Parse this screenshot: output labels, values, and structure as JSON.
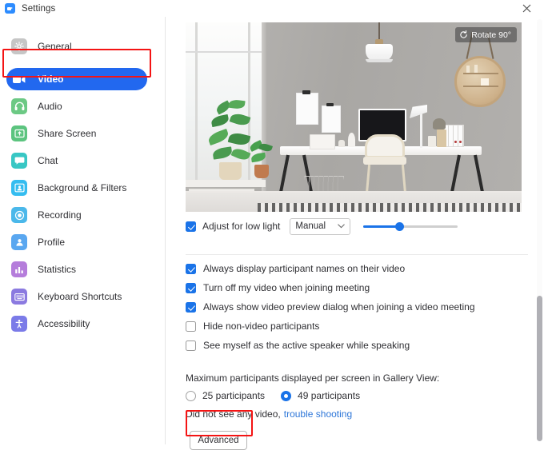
{
  "window": {
    "title": "Settings",
    "logo_icon": "zoom-logo-icon",
    "close_icon": "close-icon"
  },
  "sidebar": {
    "items": [
      {
        "label": "General",
        "icon": "gear-icon",
        "color": "#bdbdbd",
        "active": false
      },
      {
        "label": "Video",
        "icon": "video-camera-icon",
        "color": "#2268ef",
        "active": true
      },
      {
        "label": "Audio",
        "icon": "headphones-icon",
        "color": "#56c271",
        "active": false
      },
      {
        "label": "Share Screen",
        "icon": "share-screen-icon",
        "color": "#5bc47e",
        "active": false
      },
      {
        "label": "Chat",
        "icon": "chat-bubble-icon",
        "color": "#3ac7c2",
        "active": false
      },
      {
        "label": "Background & Filters",
        "icon": "person-frame-icon",
        "color": "#35bdf0",
        "active": false
      },
      {
        "label": "Recording",
        "icon": "record-icon",
        "color": "#4bb8ea",
        "active": false
      },
      {
        "label": "Profile",
        "icon": "person-icon",
        "color": "#5aa7f0",
        "active": false
      },
      {
        "label": "Statistics",
        "icon": "bar-chart-icon",
        "color": "#b croatia",
        "active": false
      },
      {
        "label": "Keyboard Shortcuts",
        "icon": "keyboard-icon",
        "color": "#8b7ae0",
        "active": false
      },
      {
        "label": "Accessibility",
        "icon": "accessibility-icon",
        "color": "#7b7be8",
        "active": false
      }
    ]
  },
  "annotations": {
    "highlight_color": "#f41414",
    "boxes": [
      "video-nav-item",
      "advanced-button"
    ]
  },
  "video_preview": {
    "rotate_button_label": "Rotate 90°",
    "rotate_icon": "rotate-icon",
    "scene_description": "modern home office interior with white desk, monitor, chair, pendant lamp, round mirror and plants by a window"
  },
  "low_light": {
    "checkbox_label": "Adjust for low light",
    "checked": true,
    "mode_select_value": "Manual",
    "slider_percent": 38
  },
  "options": [
    {
      "label": "Always display participant names on their video",
      "checked": true
    },
    {
      "label": "Turn off my video when joining meeting",
      "checked": true
    },
    {
      "label": "Always show video preview dialog when joining a video meeting",
      "checked": true
    },
    {
      "label": "Hide non-video participants",
      "checked": false
    },
    {
      "label": "See myself as the active speaker while speaking",
      "checked": false
    }
  ],
  "gallery": {
    "label": "Maximum participants displayed per screen in Gallery View:",
    "radios": [
      {
        "label": "25 participants",
        "selected": false
      },
      {
        "label": "49 participants",
        "selected": true
      }
    ]
  },
  "trouble": {
    "text": "Did not see any video,",
    "link_label": "trouble shooting",
    "link_color": "#2d76d8"
  },
  "advanced_button": {
    "label": "Advanced"
  },
  "scrollbar": {
    "thumb_color": "#b0b0b5"
  }
}
